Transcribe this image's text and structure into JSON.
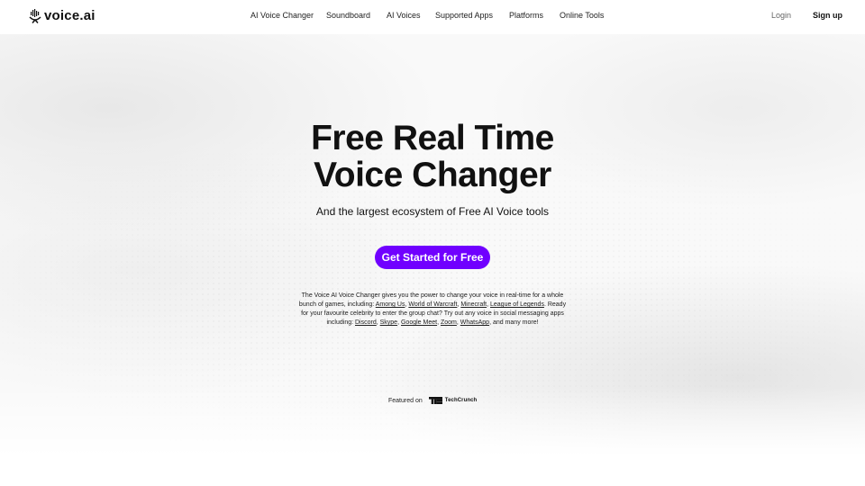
{
  "header": {
    "logo_text": "voice.ai",
    "nav": [
      {
        "label": "AI Voice Changer"
      },
      {
        "label": "Soundboard"
      },
      {
        "label": "AI Voices"
      },
      {
        "label": "Supported Apps"
      },
      {
        "label": "Platforms"
      },
      {
        "label": "Online Tools"
      }
    ],
    "login_label": "Login",
    "signup_label": "Sign up"
  },
  "hero": {
    "title_line1": "Free Real Time",
    "title_line2": "Voice Changer",
    "subtitle": "And the largest ecosystem of Free AI Voice tools",
    "cta_label": "Get Started for Free",
    "cta_color": "#7000ff"
  },
  "description": {
    "intro": "The Voice AI Voice Changer gives you the power to change your voice in real-time for a whole bunch of games, including: ",
    "games": [
      "Among Us",
      "World of Warcraft",
      "Minecraft",
      "League of Legends"
    ],
    "middle": ". Ready for your favourite celebrity to enter the group chat? Try out any voice in social messaging apps including: ",
    "apps": [
      "Discord",
      "Skype",
      "Google Meet",
      "Zoom",
      "WhatsApp"
    ],
    "ending": ", and many more!"
  },
  "featured": {
    "label": "Featured on",
    "partner": "TechCrunch"
  }
}
